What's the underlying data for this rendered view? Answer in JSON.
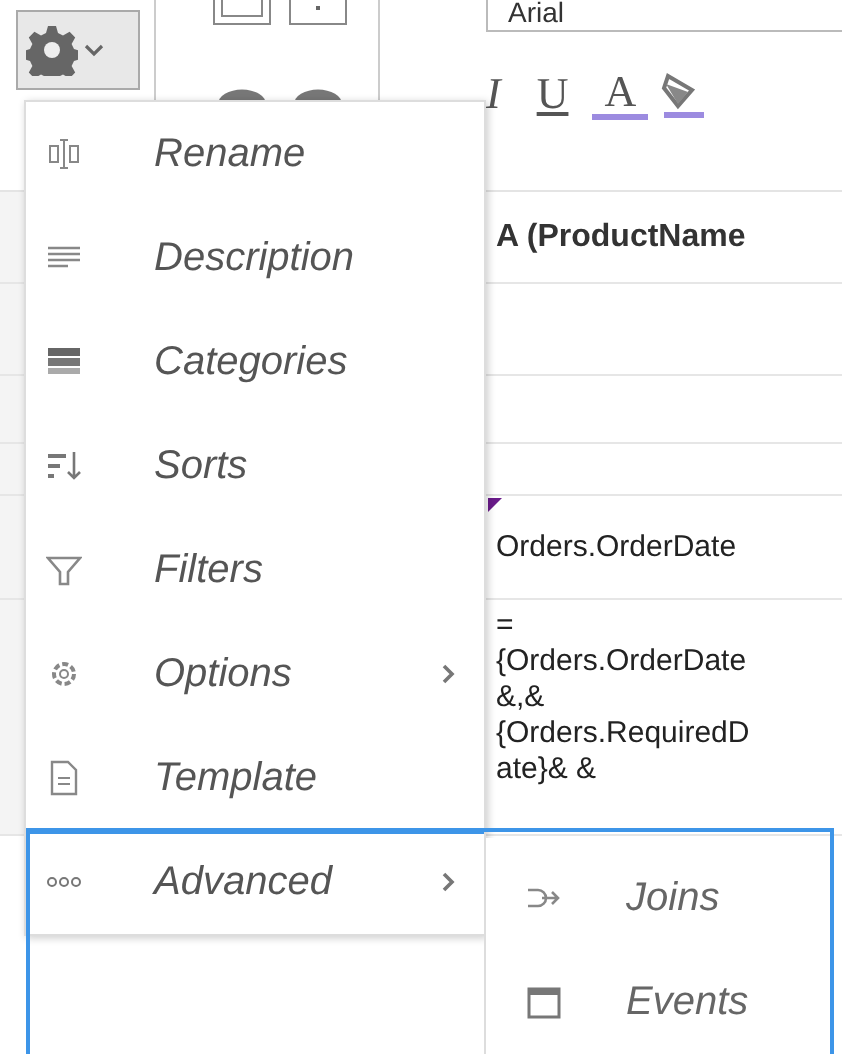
{
  "toolbar": {
    "font_field": {
      "value": "Arial"
    },
    "format_buttons": [
      {
        "label": "I",
        "kind": "italic"
      },
      {
        "label": "U",
        "kind": "underline"
      },
      {
        "label": "A",
        "kind": "color"
      }
    ]
  },
  "grid": {
    "column_header": "A (ProductName",
    "cells": [
      {
        "lines": [
          "Orders.OrderDate"
        ]
      },
      {
        "lines": [
          "=",
          "{Orders.OrderDate",
          "&,&",
          "{Orders.RequiredD",
          "ate}& &"
        ]
      }
    ]
  },
  "menu": {
    "items": [
      {
        "label": "Rename",
        "kind": "rename",
        "has_submenu": false,
        "selected": false
      },
      {
        "label": "Description",
        "kind": "description",
        "has_submenu": false,
        "selected": false
      },
      {
        "label": "Categories",
        "kind": "categories",
        "has_submenu": false,
        "selected": false
      },
      {
        "label": "Sorts",
        "kind": "sorts",
        "has_submenu": false,
        "selected": false
      },
      {
        "label": "Filters",
        "kind": "filters",
        "has_submenu": false,
        "selected": false
      },
      {
        "label": "Options",
        "kind": "options",
        "has_submenu": true,
        "selected": false
      },
      {
        "label": "Template",
        "kind": "template",
        "has_submenu": false,
        "selected": false
      },
      {
        "label": "Advanced",
        "kind": "advanced",
        "has_submenu": true,
        "selected": true
      }
    ],
    "submenu": [
      {
        "label": "Joins",
        "kind": "joins"
      },
      {
        "label": "Events",
        "kind": "events"
      }
    ]
  }
}
